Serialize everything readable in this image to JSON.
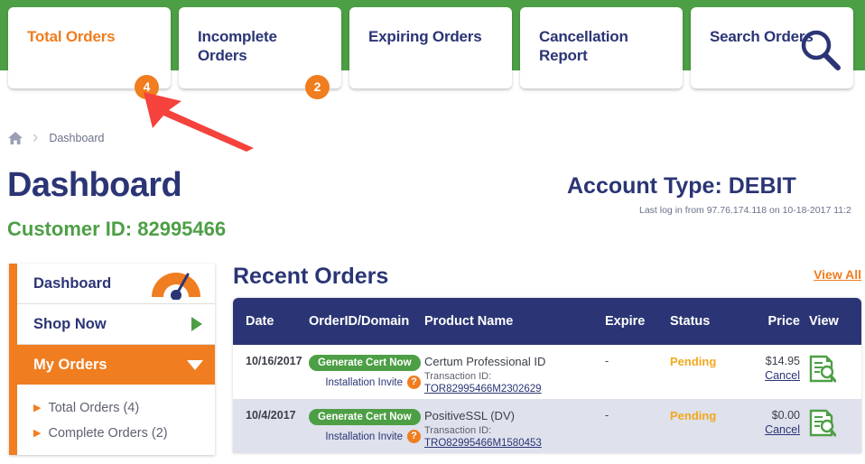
{
  "colors": {
    "green_band": "#4d9f45",
    "navy": "#2b3575",
    "orange": "#f07d1f",
    "status_pending": "#f2a81d",
    "row_alt": "#dfe1ec"
  },
  "tabs": [
    {
      "label": "Total Orders",
      "badge": "4",
      "active": true,
      "icon": ""
    },
    {
      "label": "Incomplete Orders",
      "badge": "2",
      "active": false,
      "icon": ""
    },
    {
      "label": "Expiring Orders",
      "badge": "",
      "active": false,
      "icon": ""
    },
    {
      "label": "Cancellation Report",
      "badge": "",
      "active": false,
      "icon": ""
    },
    {
      "label": "Search Orders",
      "badge": "",
      "active": false,
      "icon": "search-icon"
    }
  ],
  "breadcrumb": {
    "home_icon": "home-icon",
    "separator": "›",
    "current": "Dashboard"
  },
  "header": {
    "title": "Dashboard",
    "customer_id": "Customer ID: 82995466",
    "account_type": "Account Type: DEBIT",
    "last_login": "Last log in from 97.76.174.118 on 10-18-2017 11:2"
  },
  "sidebar": {
    "items": [
      {
        "label": "Dashboard",
        "icon": "gauge-icon"
      },
      {
        "label": "Shop Now",
        "icon": "play-triangle-icon"
      },
      {
        "label": "My Orders",
        "icon": "chevron-down-icon"
      }
    ],
    "sub_items": [
      {
        "label": "Total Orders (4)"
      },
      {
        "label": "Complete Orders (2)"
      }
    ]
  },
  "recent_orders": {
    "title": "Recent Orders",
    "view_all": "View All",
    "columns": [
      "Date",
      "OrderID/Domain",
      "Product Name",
      "Expire",
      "Status",
      "Price",
      "View"
    ],
    "rows": [
      {
        "date": "10/16/2017",
        "cert_button": "Generate Cert Now",
        "invite_label": "Installation Invite",
        "invite_help_icon": "question-mark-icon",
        "product": "Certum Professional ID",
        "txn_label": "Transaction ID:",
        "txn_id": "TOR82995466M2302629",
        "expire": "-",
        "status": "Pending",
        "price": "$14.95",
        "cancel": "Cancel",
        "view_icon": "document-search-icon"
      },
      {
        "date": "10/4/2017",
        "cert_button": "Generate Cert Now",
        "invite_label": "Installation Invite",
        "invite_help_icon": "question-mark-icon",
        "product": "PositiveSSL (DV)",
        "txn_label": "Transaction ID:",
        "txn_id": "TRO82995466M1580453",
        "expire": "-",
        "status": "Pending",
        "price": "$0.00",
        "cancel": "Cancel",
        "view_icon": "document-search-icon"
      }
    ]
  },
  "annotation": {
    "type": "red-arrow",
    "color": "#f5423c",
    "points_to": "Total Orders tab badge"
  }
}
